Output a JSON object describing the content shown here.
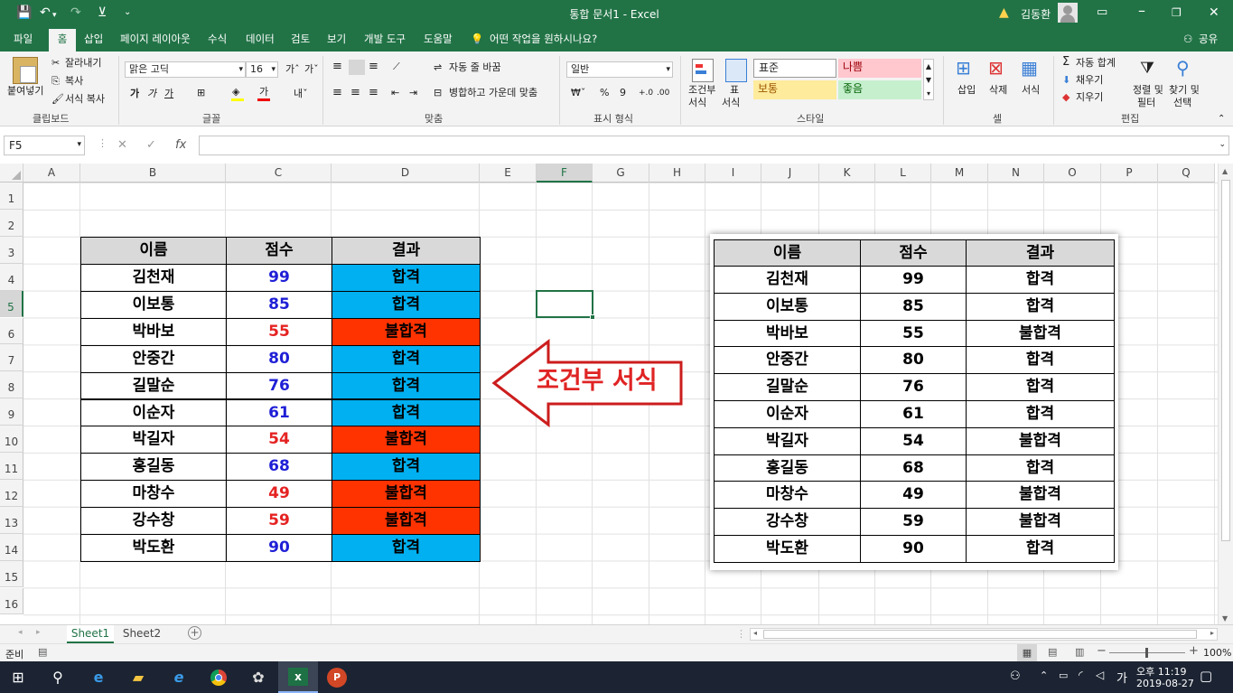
{
  "window": {
    "title": "통합 문서1  -  Excel",
    "user": "김동환"
  },
  "tabs": [
    "파일",
    "홈",
    "삽입",
    "페이지 레이아웃",
    "수식",
    "데이터",
    "검토",
    "보기",
    "개발 도구",
    "도움말"
  ],
  "tell_me": "어떤 작업을 원하시나요?",
  "share": "공유",
  "ribbon": {
    "clipboard": {
      "paste": "붙여넣기",
      "cut": "잘라내기",
      "copy": "복사",
      "format_painter": "서식 복사",
      "label": "클립보드"
    },
    "font": {
      "name": "맑은 고딕",
      "size": "16",
      "bold": "가",
      "italic": "가",
      "underline": "가",
      "label": "글꼴"
    },
    "align": {
      "wrap": "자동 줄 바꿈",
      "merge": "병합하고 가운데 맞춤",
      "label": "맞춤"
    },
    "number": {
      "format": "일반",
      "percent": "%",
      "comma": "9",
      "label": "표시 형식"
    },
    "styles": {
      "conditional": "조건부\n서식",
      "conditional_l1": "조건부",
      "conditional_l2": "서식",
      "table_l1": "표",
      "table_l2": "서식",
      "normal": "표준",
      "bad": "나쁨",
      "neutral": "보통",
      "good": "좋음",
      "label": "스타일"
    },
    "cells": {
      "insert": "삽입",
      "delete": "삭제",
      "format": "서식",
      "label": "셀"
    },
    "editing": {
      "autosum": "자동 합계",
      "fill": "채우기",
      "clear": "지우기",
      "sort_l1": "정렬 및",
      "sort_l2": "필터",
      "find_l1": "찾기 및",
      "find_l2": "선택",
      "label": "편집"
    }
  },
  "formula_bar": {
    "name_box": "F5",
    "fx": "fx",
    "cancel": "✕",
    "enter": "✓",
    "value": ""
  },
  "columns": [
    "A",
    "B",
    "C",
    "D",
    "E",
    "F",
    "G",
    "H",
    "I",
    "J",
    "K",
    "L",
    "M",
    "N",
    "O",
    "P",
    "Q"
  ],
  "rows": [
    "1",
    "2",
    "3",
    "4",
    "5",
    "6",
    "7",
    "8",
    "9",
    "10",
    "11",
    "12",
    "13",
    "14",
    "15",
    "16"
  ],
  "table": {
    "headers": [
      "이름",
      "점수",
      "결과"
    ],
    "rows": [
      {
        "name": "김천재",
        "score": "99",
        "result": "합격"
      },
      {
        "name": "이보통",
        "score": "85",
        "result": "합격"
      },
      {
        "name": "박바보",
        "score": "55",
        "result": "불합격"
      },
      {
        "name": "안중간",
        "score": "80",
        "result": "합격"
      },
      {
        "name": "길말순",
        "score": "76",
        "result": "합격"
      },
      {
        "name": "이순자",
        "score": "61",
        "result": "합격"
      },
      {
        "name": "박길자",
        "score": "54",
        "result": "불합격"
      },
      {
        "name": "홍길동",
        "score": "68",
        "result": "합격"
      },
      {
        "name": "마창수",
        "score": "49",
        "result": "불합격"
      },
      {
        "name": "강수창",
        "score": "59",
        "result": "불합격"
      },
      {
        "name": "박도환",
        "score": "90",
        "result": "합격"
      }
    ]
  },
  "arrow_label": "조건부 서식",
  "colors": {
    "pass": "#00b0f0",
    "fail": "#ff3300",
    "high": "#1f1fd6",
    "low": "#e52222",
    "excel_green": "#217346"
  },
  "sheets": [
    "Sheet1",
    "Sheet2"
  ],
  "status": {
    "ready": "준비",
    "zoom": "100%"
  },
  "taskbar": {
    "time_l1": "오후 11:19",
    "time_l2": "2019-08-27",
    "ime": "가"
  }
}
